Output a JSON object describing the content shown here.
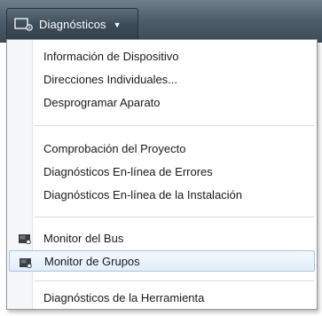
{
  "menu_button": {
    "label": "Diagnósticos",
    "icon": "monitor-icon",
    "caret_icon": "caret-down-icon"
  },
  "menu": {
    "groups": [
      {
        "items": [
          {
            "label": "Información de Dispositivo"
          },
          {
            "label": "Direcciones Individuales..."
          },
          {
            "label": "Desprogramar Aparato"
          }
        ]
      },
      {
        "items": [
          {
            "label": "Comprobación del Proyecto"
          },
          {
            "label": "Diagnósticos En-línea de Errores"
          },
          {
            "label": "Diagnósticos En-línea de la Instalación"
          }
        ]
      },
      {
        "items": [
          {
            "label": "Monitor del Bus",
            "icon": "monitor-icon"
          },
          {
            "label": "Monitor de Grupos",
            "icon": "monitor-icon",
            "highlighted": true
          }
        ]
      },
      {
        "items": [
          {
            "label": "Diagnósticos de la Herramienta"
          }
        ]
      }
    ]
  },
  "colors": {
    "ribbon": "#3e4d5a",
    "hover_bg": "#e3eef9",
    "hover_border": "#a9c5e3",
    "menu_border": "#8d96a0"
  }
}
